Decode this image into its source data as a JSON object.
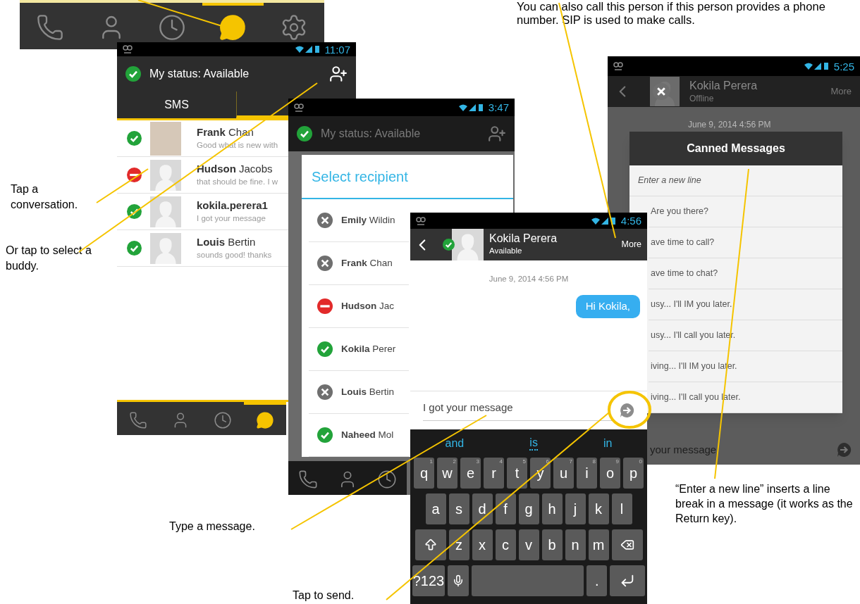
{
  "callouts": [
    {
      "text": "You can also call this person if this person provides a phone number. SIP is used to make calls."
    },
    {
      "text": "Tap a conversation."
    },
    {
      "text": "Or tap to select a buddy."
    },
    {
      "text": "Type a message."
    },
    {
      "text": "Tap to send."
    },
    {
      "text": "“Enter a new line” inserts a line break in a message (it works as the Return key)."
    }
  ],
  "nav_bar": {
    "items": [
      {
        "kind": "phone",
        "selected": false
      },
      {
        "kind": "contacts",
        "selected": false
      },
      {
        "kind": "history",
        "selected": false
      },
      {
        "kind": "chat",
        "selected": true
      },
      {
        "kind": "settings",
        "selected": false
      }
    ]
  },
  "conversations_screen": {
    "time": "11:07",
    "status": {
      "kind": "available",
      "label": "My status: Available"
    },
    "tabs": [
      {
        "label": "SMS",
        "selected": false
      },
      {
        "selected": true
      }
    ],
    "conversations": [
      {
        "kind": "available",
        "photo": true,
        "name": "**Frank** Chan",
        "bold": false,
        "preview": "Good what is new with"
      },
      {
        "kind": "busy",
        "photo": false,
        "name": "**Hudson** Jacobs",
        "bold": false,
        "preview": "that should be fine. I w"
      },
      {
        "kind": "available",
        "photo": false,
        "name": "kokila.perera1",
        "bold": true,
        "preview": "I got your message"
      },
      {
        "kind": "available",
        "photo": false,
        "name": "**Louis** Bertin",
        "bold": false,
        "preview": "sounds good! thanks"
      }
    ],
    "nav": [
      {
        "kind": "phone",
        "selected": false
      },
      {
        "kind": "contacts",
        "selected": false
      },
      {
        "kind": "history",
        "selected": false
      },
      {
        "kind": "chat",
        "selected": true
      }
    ]
  },
  "recipient_screen": {
    "time": "3:47",
    "status": {
      "kind": "available",
      "label": "My status: Available"
    },
    "dialog_title": "Select recipient",
    "recipients": [
      {
        "kind": "offline",
        "name": "**Emily** Wildin"
      },
      {
        "kind": "offline",
        "name": "**Frank** Chan"
      },
      {
        "kind": "busy",
        "name": "**Hudson** Jac"
      },
      {
        "kind": "available",
        "name": "**Kokila** Perer"
      },
      {
        "kind": "offline",
        "name": "**Louis** Bertin"
      },
      {
        "kind": "available",
        "name": "**Naheed** Mol"
      }
    ],
    "nav": [
      {
        "kind": "phone",
        "selected": false
      },
      {
        "kind": "contacts",
        "selected": false
      },
      {
        "kind": "history",
        "selected": false
      }
    ]
  },
  "chat_screen": {
    "time": "4:56",
    "contact": {
      "name": "Kokila Perera",
      "kind": "available",
      "status_label": "Available"
    },
    "more": "More",
    "date": "June 9, 2014 4:56 PM",
    "messages": [
      {
        "text": "Hi Kokila,",
        "outgoing": true
      }
    ],
    "input": {
      "value": "I got your message"
    },
    "keyboard": {
      "suggestions": [
        {
          "text": "and",
          "selected": false
        },
        {
          "text": "is",
          "selected": true
        },
        {
          "text": "in",
          "selected": false
        }
      ],
      "rows": [
        {
          "keys": [
            {
              "kind": "char",
              "label": "q",
              "hint": "1"
            },
            {
              "kind": "char",
              "label": "w",
              "hint": "2"
            },
            {
              "kind": "char",
              "label": "e",
              "hint": "3"
            },
            {
              "kind": "char",
              "label": "r",
              "hint": "4"
            },
            {
              "kind": "char",
              "label": "t",
              "hint": "5"
            },
            {
              "kind": "char",
              "label": "y",
              "hint": "6"
            },
            {
              "kind": "char",
              "label": "u",
              "hint": "7"
            },
            {
              "kind": "char",
              "label": "i",
              "hint": "8"
            },
            {
              "kind": "char",
              "label": "o",
              "hint": "9"
            },
            {
              "kind": "char",
              "label": "p",
              "hint": "0"
            }
          ]
        },
        {
          "keys": [
            {
              "kind": "char",
              "label": "a"
            },
            {
              "kind": "char",
              "label": "s"
            },
            {
              "kind": "char",
              "label": "d"
            },
            {
              "kind": "char",
              "label": "f"
            },
            {
              "kind": "char",
              "label": "g"
            },
            {
              "kind": "char",
              "label": "h"
            },
            {
              "kind": "char",
              "label": "j"
            },
            {
              "kind": "char",
              "label": "k"
            },
            {
              "kind": "char",
              "label": "l"
            }
          ]
        },
        {
          "keys": [
            {
              "kind": "shift"
            },
            {
              "kind": "char",
              "label": "z"
            },
            {
              "kind": "char",
              "label": "x"
            },
            {
              "kind": "char",
              "label": "c"
            },
            {
              "kind": "char",
              "label": "v"
            },
            {
              "kind": "char",
              "label": "b"
            },
            {
              "kind": "char",
              "label": "n"
            },
            {
              "kind": "char",
              "label": "m"
            },
            {
              "kind": "backspace"
            }
          ]
        },
        {
          "keys": [
            {
              "kind": "symbols",
              "label": "?123"
            },
            {
              "kind": "mic"
            },
            {
              "kind": "space"
            },
            {
              "kind": "char",
              "label": "."
            },
            {
              "kind": "enter"
            }
          ]
        }
      ]
    }
  },
  "canned_screen": {
    "time": "5:25",
    "contact": {
      "name": "Kokila Perera",
      "kind": "offline",
      "status_label": "Offline"
    },
    "more": "More",
    "date": "June 9, 2014 4:56 PM",
    "dialog_title": "Canned Messages",
    "items": [
      {
        "text": "Enter a new line",
        "italic": true
      },
      {
        "text": "Are you there?",
        "italic": false
      },
      {
        "text": "ave time to call?",
        "italic": false
      },
      {
        "text": "ave time to chat?",
        "italic": false
      },
      {
        "text": "usy... I'll IM you later.",
        "italic": false
      },
      {
        "text": "usy... I'll call you later.",
        "italic": false
      },
      {
        "text": "iving... I'll IM you later.",
        "italic": false
      },
      {
        "text": "iving... I'll call you later.",
        "italic": false
      }
    ],
    "input": {
      "value": "your message"
    }
  }
}
